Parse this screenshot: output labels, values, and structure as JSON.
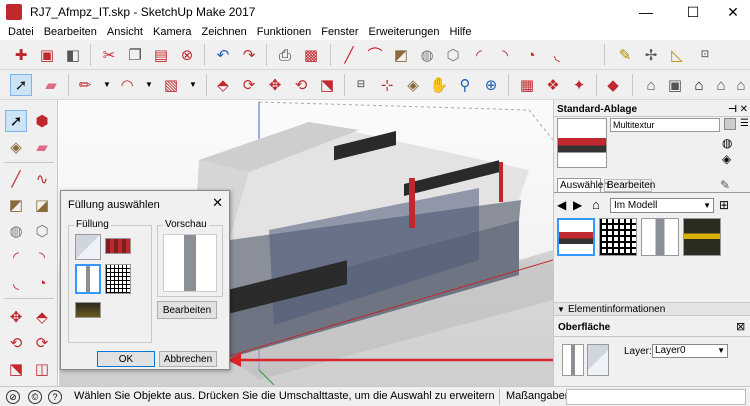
{
  "window": {
    "title": "RJ7_Afmpz_IT.skp - SketchUp Make 2017",
    "minimize": "—",
    "maximize": "☐",
    "close": "✕"
  },
  "menu": [
    "Datei",
    "Bearbeiten",
    "Ansicht",
    "Kamera",
    "Zeichnen",
    "Funktionen",
    "Fenster",
    "Erweiterungen",
    "Hilfe"
  ],
  "icons": {
    "toolbar1": [
      "new-file-icon",
      "open-icon",
      "save-icon",
      "cut-icon",
      "copy-icon",
      "paste-icon",
      "erase-icon",
      "undo-icon",
      "redo-icon",
      "print-icon",
      "model-info-icon",
      "line-icon",
      "arc-icon",
      "rectangle-icon",
      "circle-icon",
      "polygon-icon",
      "arc-2-icon",
      "arc-3-icon",
      "pie-icon",
      "tape-measure-icon",
      "protractor-icon",
      "dimension-icon",
      "text-icon"
    ],
    "toolbar2": [
      "select-icon",
      "eraser-icon",
      "pencil-icon",
      "arc-tool-icon",
      "push-pull-icon",
      "move-icon",
      "rotate-icon",
      "scale-icon",
      "offset-icon",
      "text-tool-icon",
      "paint-bucket-icon",
      "orbit-icon",
      "pan-icon",
      "zoom-icon",
      "zoom-extents-icon",
      "warehouse-icon",
      "components-icon",
      "extension-icon",
      "ruby-icon",
      "iso-view-icon",
      "top-view-icon",
      "front-view-icon",
      "right-view-icon",
      "back-view-icon",
      "left-view-icon"
    ]
  },
  "dialog": {
    "title": "Füllung auswählen",
    "close": "✕",
    "group_fill": "Füllung",
    "group_preview": "Vorschau",
    "edit_button": "Bearbeiten",
    "ok_button": "OK",
    "cancel_button": "Abbrechen"
  },
  "panel": {
    "tray_title": "Standard-Ablage",
    "pin": "⊠",
    "material_name": "Multitextur",
    "tabs": [
      "Auswählen",
      "Bearbeiten"
    ],
    "collection": "Im Modell",
    "entity_header": "Elementinformationen",
    "entity_type": "Oberfläche",
    "layer_label": "Layer:",
    "layer_value": "Layer0"
  },
  "status": {
    "message": "Wählen Sie Objekte aus. Drücken Sie die Umschalttaste, um die Auswahl zu erweitern. Zi...",
    "measurements_label": "Maßangaben"
  },
  "colors": {
    "annotation_arrow": "#d9252a",
    "accent": "#c0282d",
    "panel_bg": "#f0f0f0",
    "selection": "#3399ff"
  }
}
